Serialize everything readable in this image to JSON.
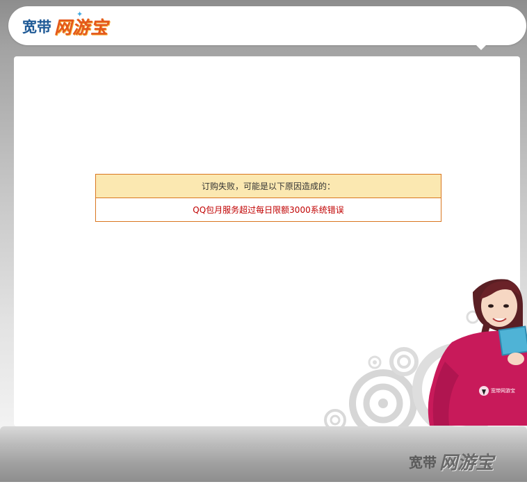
{
  "header": {
    "logo_part1": "宽带",
    "logo_part2": "网游宝"
  },
  "notice": {
    "title": "订购失败，可能是以下原因造成的：",
    "message": "QQ包月服务超过每日限额3000系统错误"
  },
  "illustration": {
    "shirt_text": "宽带网游宝"
  },
  "footer": {
    "logo_part1": "宽带",
    "logo_part2": "网游宝"
  },
  "colors": {
    "notice_border": "#d9761f",
    "notice_header_bg": "#fbe8b1",
    "error_text": "#c00000",
    "logo_blue": "#1f5a96",
    "logo_orange": "#e3571b"
  }
}
